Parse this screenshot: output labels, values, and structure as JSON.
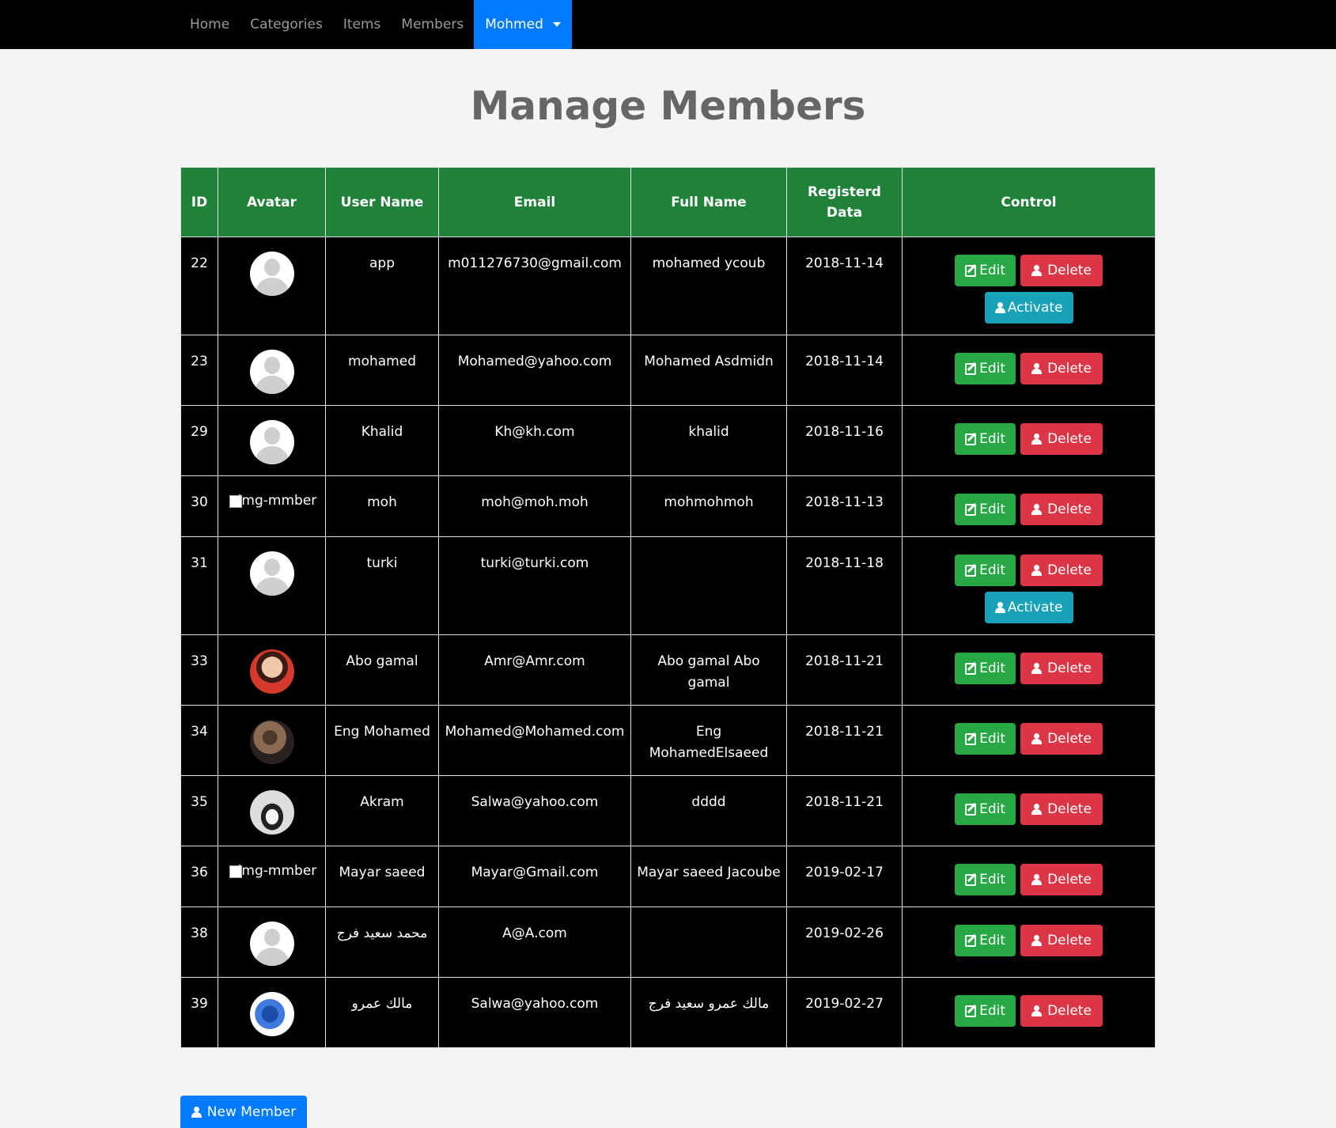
{
  "nav": {
    "items": [
      "Home",
      "Categories",
      "Items",
      "Members"
    ],
    "user": "Mohmed"
  },
  "page": {
    "title": "Manage Members"
  },
  "table": {
    "headers": {
      "id": "ID",
      "avatar": "Avatar",
      "username": "User Name",
      "email": "Email",
      "fullname": "Full Name",
      "registered": "Registerd Data",
      "control": "Control"
    },
    "rows": [
      {
        "id": "22",
        "avatar": "default",
        "username": "app",
        "email": "m011276730@gmail.com",
        "fullname": "mohamed ycoub",
        "date": "2018-11-14",
        "activate": true
      },
      {
        "id": "23",
        "avatar": "default",
        "username": "mohamed",
        "email": "Mohamed@yahoo.com",
        "fullname": "Mohamed Asdmidn",
        "date": "2018-11-14",
        "activate": false
      },
      {
        "id": "29",
        "avatar": "default",
        "username": "Khalid",
        "email": "Kh@kh.com",
        "fullname": "khalid",
        "date": "2018-11-16",
        "activate": false
      },
      {
        "id": "30",
        "avatar": "broken",
        "username": "moh",
        "email": "moh@moh.moh",
        "fullname": "mohmohmoh",
        "date": "2018-11-13",
        "activate": false
      },
      {
        "id": "31",
        "avatar": "default",
        "username": "turki",
        "email": "turki@turki.com",
        "fullname": "",
        "date": "2018-11-18",
        "activate": true
      },
      {
        "id": "33",
        "avatar": "photo-cartoon",
        "username": "Abo gamal",
        "email": "Amr@Amr.com",
        "fullname": "Abo gamal Abo gamal",
        "date": "2018-11-21",
        "activate": false
      },
      {
        "id": "34",
        "avatar": "photo-a",
        "username": "Eng Mohamed",
        "email": "Mohamed@Mohamed.com",
        "fullname": "Eng MohamedElsaeed",
        "date": "2018-11-21",
        "activate": false
      },
      {
        "id": "35",
        "avatar": "photo-b",
        "username": "Akram",
        "email": "Salwa@yahoo.com",
        "fullname": "dddd",
        "date": "2018-11-21",
        "activate": false
      },
      {
        "id": "36",
        "avatar": "broken",
        "username": "Mayar saeed",
        "email": "Mayar@Gmail.com",
        "fullname": "Mayar saeed Jacoube",
        "date": "2019-02-17",
        "activate": false
      },
      {
        "id": "38",
        "avatar": "default",
        "username": "محمد سعيد فرج",
        "email": "A@A.com",
        "fullname": "",
        "date": "2019-02-26",
        "activate": false
      },
      {
        "id": "39",
        "avatar": "photo-c",
        "username": "مالك عمرو",
        "email": "Salwa@yahoo.com",
        "fullname": "مالك عمرو سعيد فرج",
        "date": "2019-02-27",
        "activate": false
      }
    ],
    "buttons": {
      "edit": "Edit",
      "delete": "Delete",
      "activate": "Activate"
    },
    "broken_img_alt": "img-mmber"
  },
  "footer": {
    "new_member": "New Member"
  },
  "colors": {
    "header_bg": "#208238",
    "edit": "#28a745",
    "delete": "#dc3545",
    "activate": "#17a2b8",
    "primary": "#007bff"
  }
}
